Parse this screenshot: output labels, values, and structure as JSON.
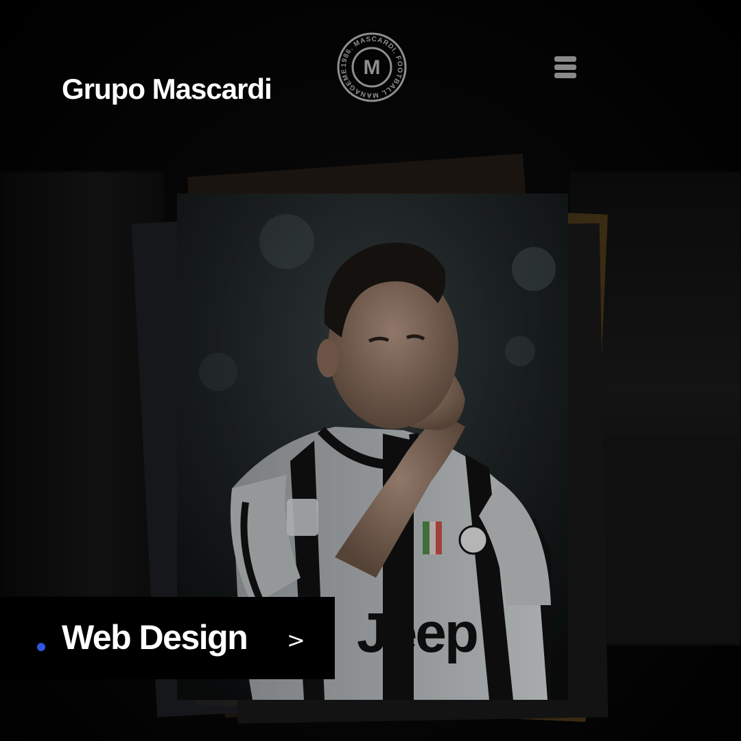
{
  "header": {
    "brand": "Grupo Mascardi",
    "logo": {
      "icon": "mascardi-seal-logo",
      "letter": "M",
      "ring_text": "1986. MASCARDI. FOOTBALL MANAGEMENT"
    },
    "menu_icon": "hamburger-menu-icon"
  },
  "hero": {
    "image_icon": "football-player-photo",
    "jersey_text": "Jeep"
  },
  "label": {
    "text": "Web Design",
    "arrow": ">"
  },
  "colors": {
    "background": "#000000",
    "accent_dot": "#2f55e0",
    "text": "#ffffff",
    "menu_icon": "#8a8a8a"
  }
}
